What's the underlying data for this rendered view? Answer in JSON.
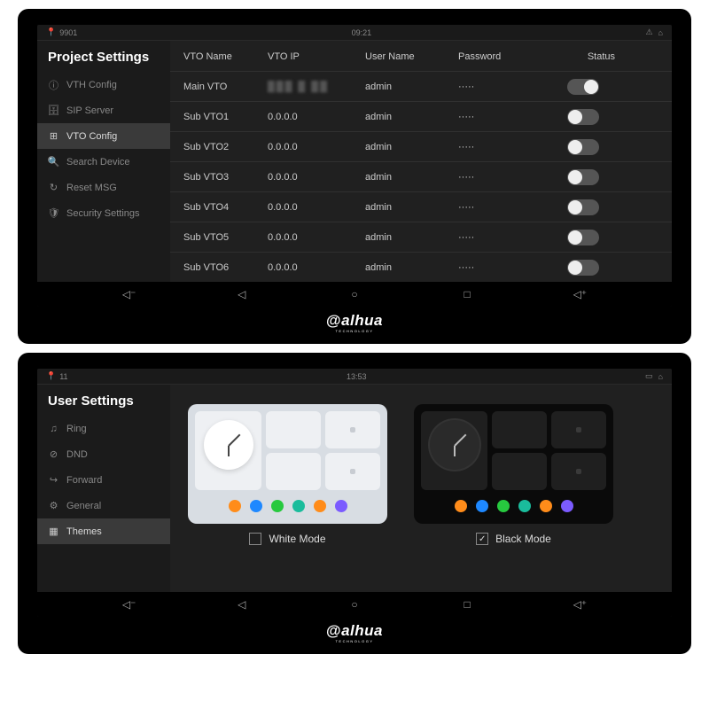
{
  "device_top": {
    "status": {
      "location_id": "9901",
      "time": "09:21"
    },
    "sidebar": {
      "title": "Project Settings",
      "items": [
        {
          "icon": "ⓘ",
          "label": "VTH Config"
        },
        {
          "icon": "🗄",
          "label": "SIP Server"
        },
        {
          "icon": "⊞",
          "label": "VTO Config",
          "active": true
        },
        {
          "icon": "🔍",
          "label": "Search Device"
        },
        {
          "icon": "↻",
          "label": "Reset MSG"
        },
        {
          "icon": "🛡",
          "label": "Security Settings"
        }
      ]
    },
    "table": {
      "headers": {
        "name": "VTO Name",
        "ip": "VTO IP",
        "user": "User Name",
        "pass": "Password",
        "status": "Status"
      },
      "rows": [
        {
          "name": "Main VTO",
          "ip": "",
          "ip_hidden": true,
          "user": "admin",
          "pass": "·····",
          "on": true
        },
        {
          "name": "Sub VTO1",
          "ip": "0.0.0.0",
          "user": "admin",
          "pass": "·····",
          "on": false
        },
        {
          "name": "Sub VTO2",
          "ip": "0.0.0.0",
          "user": "admin",
          "pass": "·····",
          "on": false
        },
        {
          "name": "Sub VTO3",
          "ip": "0.0.0.0",
          "user": "admin",
          "pass": "·····",
          "on": false
        },
        {
          "name": "Sub VTO4",
          "ip": "0.0.0.0",
          "user": "admin",
          "pass": "·····",
          "on": false
        },
        {
          "name": "Sub VTO5",
          "ip": "0.0.0.0",
          "user": "admin",
          "pass": "·····",
          "on": false
        },
        {
          "name": "Sub VTO6",
          "ip": "0.0.0.0",
          "user": "admin",
          "pass": "·····",
          "on": false
        }
      ]
    },
    "brand": "alhua",
    "brand_sub": "TECHNOLOGY"
  },
  "device_bottom": {
    "status": {
      "location_id": "11",
      "time": "13:53"
    },
    "sidebar": {
      "title": "User Settings",
      "items": [
        {
          "icon": "♫",
          "label": "Ring"
        },
        {
          "icon": "⊘",
          "label": "DND"
        },
        {
          "icon": "↪",
          "label": "Forward"
        },
        {
          "icon": "⚙",
          "label": "General"
        },
        {
          "icon": "▦",
          "label": "Themes",
          "active": true
        }
      ]
    },
    "themes": {
      "white_label": "White Mode",
      "black_label": "Black Mode",
      "selected": "black"
    },
    "brand": "alhua",
    "brand_sub": "TECHNOLOGY"
  },
  "dock_colors": [
    "#ff8c1a",
    "#1e88ff",
    "#27c93f",
    "#1abc9c",
    "#ff8c1a",
    "#7b5bff"
  ]
}
